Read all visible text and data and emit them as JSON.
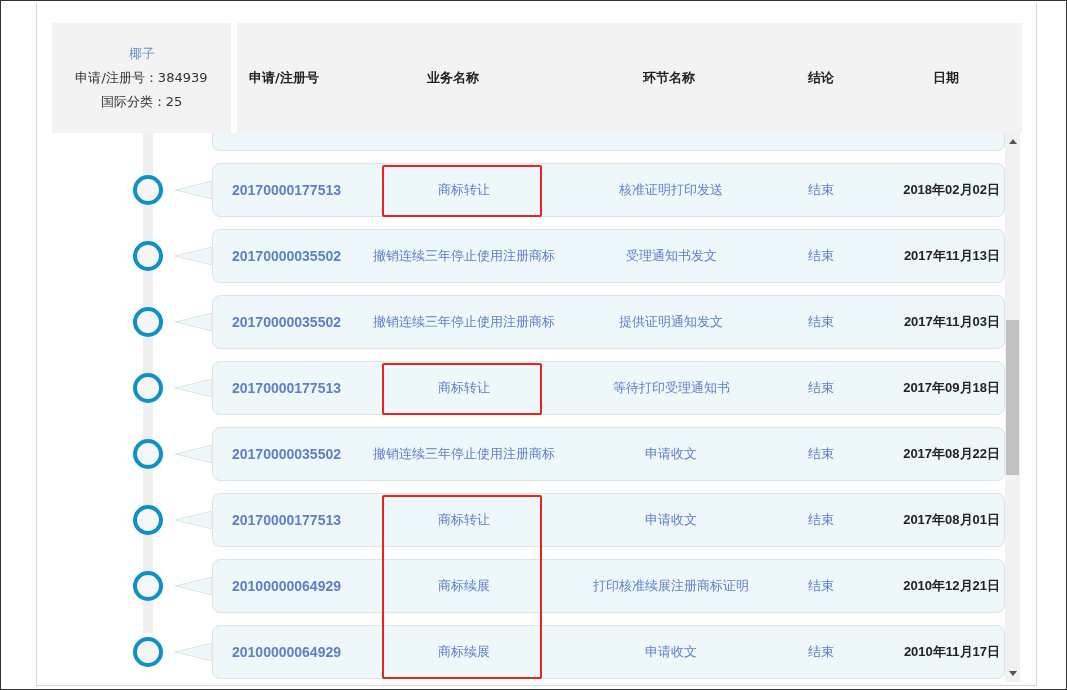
{
  "item": {
    "name": "椰子",
    "reg_label": "申请/注册号：384939",
    "class_label": "国际分类：25"
  },
  "columns": [
    "申请/注册号",
    "业务名称",
    "环节名称",
    "结论",
    "日期"
  ],
  "rows": [
    {
      "number": "20170000177513",
      "business": "商标转让",
      "stage": "核准证明打印发送",
      "conclusion": "结束",
      "date": "2018年02月02日",
      "highlighted": true
    },
    {
      "number": "20170000035502",
      "business": "撤销连续三年停止使用注册商标",
      "stage": "受理通知书发文",
      "conclusion": "结束",
      "date": "2017年11月13日",
      "highlighted": false
    },
    {
      "number": "20170000035502",
      "business": "撤销连续三年停止使用注册商标",
      "stage": "提供证明通知发文",
      "conclusion": "结束",
      "date": "2017年11月03日",
      "highlighted": false
    },
    {
      "number": "20170000177513",
      "business": "商标转让",
      "stage": "等待打印受理通知书",
      "conclusion": "结束",
      "date": "2017年09月18日",
      "highlighted": true
    },
    {
      "number": "20170000035502",
      "business": "撤销连续三年停止使用注册商标",
      "stage": "申请收文",
      "conclusion": "结束",
      "date": "2017年08月22日",
      "highlighted": false
    },
    {
      "number": "20170000177513",
      "business": "商标转让",
      "stage": "申请收文",
      "conclusion": "结束",
      "date": "2017年08月01日",
      "highlighted": true
    },
    {
      "number": "20100000064929",
      "business": "商标续展",
      "stage": "打印核准续展注册商标证明",
      "conclusion": "结束",
      "date": "2010年12月21日",
      "highlighted": true
    },
    {
      "number": "20100000064929",
      "business": "商标续展",
      "stage": "申请收文",
      "conclusion": "结束",
      "date": "2010年11月17日",
      "highlighted": true
    }
  ]
}
